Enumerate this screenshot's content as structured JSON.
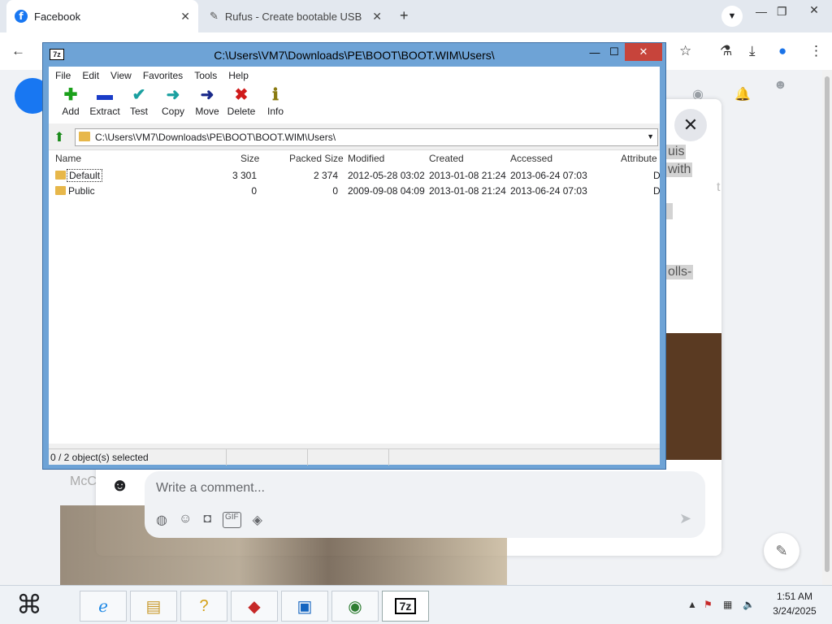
{
  "browser": {
    "tabs": [
      {
        "title": "Facebook",
        "active": true
      },
      {
        "title": "Rufus - Create bootable USB di",
        "active": false
      }
    ],
    "new_tab_icon": "plus-icon",
    "window_controls": [
      "minimize-icon",
      "restore-icon",
      "close-icon"
    ]
  },
  "facebook": {
    "comment_placeholder": "Write a comment...",
    "close_icon": "close-icon",
    "highlight_texts": [
      "uis",
      "with",
      "t",
      "olls-"
    ],
    "name_partial": "McC"
  },
  "sevenzip": {
    "title": "C:\\Users\\VM7\\Downloads\\PE\\BOOT\\BOOT.WIM\\Users\\",
    "app_icon": "7z",
    "menu": [
      "File",
      "Edit",
      "View",
      "Favorites",
      "Tools",
      "Help"
    ],
    "toolbar": [
      {
        "label": "Add",
        "icon": "plus-icon",
        "color": "#1aa01a"
      },
      {
        "label": "Extract",
        "icon": "minus-icon",
        "color": "#1a3cc8"
      },
      {
        "label": "Test",
        "icon": "check-icon",
        "color": "#1aa0a0"
      },
      {
        "label": "Copy",
        "icon": "arrow-right-icon",
        "color": "#1aa0a0"
      },
      {
        "label": "Move",
        "icon": "arrow-right-icon",
        "color": "#1a2a8a"
      },
      {
        "label": "Delete",
        "icon": "x-icon",
        "color": "#d01a1a"
      },
      {
        "label": "Info",
        "icon": "info-icon",
        "color": "#8a7a10"
      }
    ],
    "address": "C:\\Users\\VM7\\Downloads\\PE\\BOOT\\BOOT.WIM\\Users\\",
    "columns": [
      "Name",
      "Size",
      "Packed Size",
      "Modified",
      "Created",
      "Accessed",
      "Attribute"
    ],
    "rows": [
      {
        "name": "Default",
        "size": "3 301",
        "packed": "2 374",
        "modified": "2012-05-28 03:02",
        "created": "2013-01-08 21:24",
        "accessed": "2013-06-24 07:03",
        "attr": "D"
      },
      {
        "name": "Public",
        "size": "0",
        "packed": "0",
        "modified": "2009-09-08 04:09",
        "created": "2013-01-08 21:24",
        "accessed": "2013-06-24 07:03",
        "attr": "D"
      }
    ],
    "status": "0 / 2 object(s) selected"
  },
  "taskbar": {
    "time": "1:51 AM",
    "date": "3/24/2025",
    "apps": [
      "internet-explorer-icon",
      "file-explorer-icon",
      "help-icon",
      "app-red-icon",
      "control-panel-icon",
      "chrome-icon",
      "7zip-icon"
    ],
    "pinned_label": "7z"
  }
}
